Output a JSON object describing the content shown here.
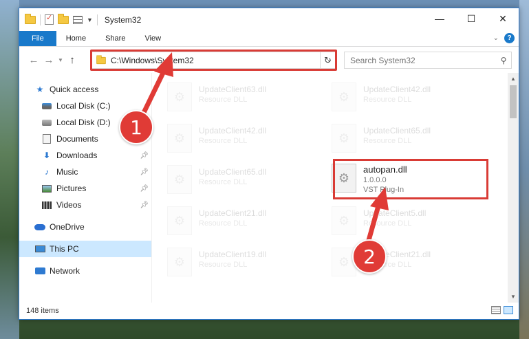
{
  "window": {
    "title": "System32",
    "controls": {
      "minimize": "—",
      "maximize": "☐",
      "close": "✕"
    }
  },
  "ribbon": {
    "tabs": [
      "File",
      "Home",
      "Share",
      "View"
    ]
  },
  "address_bar": {
    "path": "C:\\Windows\\System32"
  },
  "search": {
    "placeholder": "Search System32"
  },
  "nav": {
    "quick_access": "Quick access",
    "items": [
      {
        "label": "Local Disk (C:)",
        "icon": "system-disk-icon",
        "pinned": false
      },
      {
        "label": "Local Disk (D:)",
        "icon": "disk-icon",
        "pinned": false
      },
      {
        "label": "Documents",
        "icon": "documents-icon",
        "pinned": true
      },
      {
        "label": "Downloads",
        "icon": "downloads-icon",
        "pinned": true
      },
      {
        "label": "Music",
        "icon": "music-icon",
        "pinned": true
      },
      {
        "label": "Pictures",
        "icon": "pictures-icon",
        "pinned": true
      },
      {
        "label": "Videos",
        "icon": "videos-icon",
        "pinned": true
      }
    ],
    "onedrive": "OneDrive",
    "this_pc": "This PC",
    "network": "Network"
  },
  "files": {
    "left": [
      {
        "name": "UpdateClient63.dll",
        "type": "Resource DLL"
      },
      {
        "name": "UpdateClient42.dll",
        "type": "Resource DLL"
      },
      {
        "name": "UpdateClient65.dll",
        "type": "Resource DLL"
      },
      {
        "name": "UpdateClient21.dll",
        "type": "Resource DLL"
      },
      {
        "name": "UpdateClient19.dll",
        "type": "Resource DLL"
      }
    ],
    "right": [
      {
        "name": "UpdateClient42.dll",
        "type": "Resource DLL"
      },
      {
        "name": "UpdateClient65.dll",
        "type": "Resource DLL"
      },
      {
        "name": "UpdateClient5.dll",
        "type": "Resource DLL"
      },
      {
        "name": "UpdateClient21.dll",
        "type": "Resource DLL"
      }
    ],
    "highlighted": {
      "name": "autopan.dll",
      "version": "1.0.0.0",
      "type": "VST Plug-In"
    }
  },
  "status": {
    "item_count": "148 items"
  },
  "annotations": {
    "step1": "1",
    "step2": "2",
    "color": "#e03b36"
  }
}
